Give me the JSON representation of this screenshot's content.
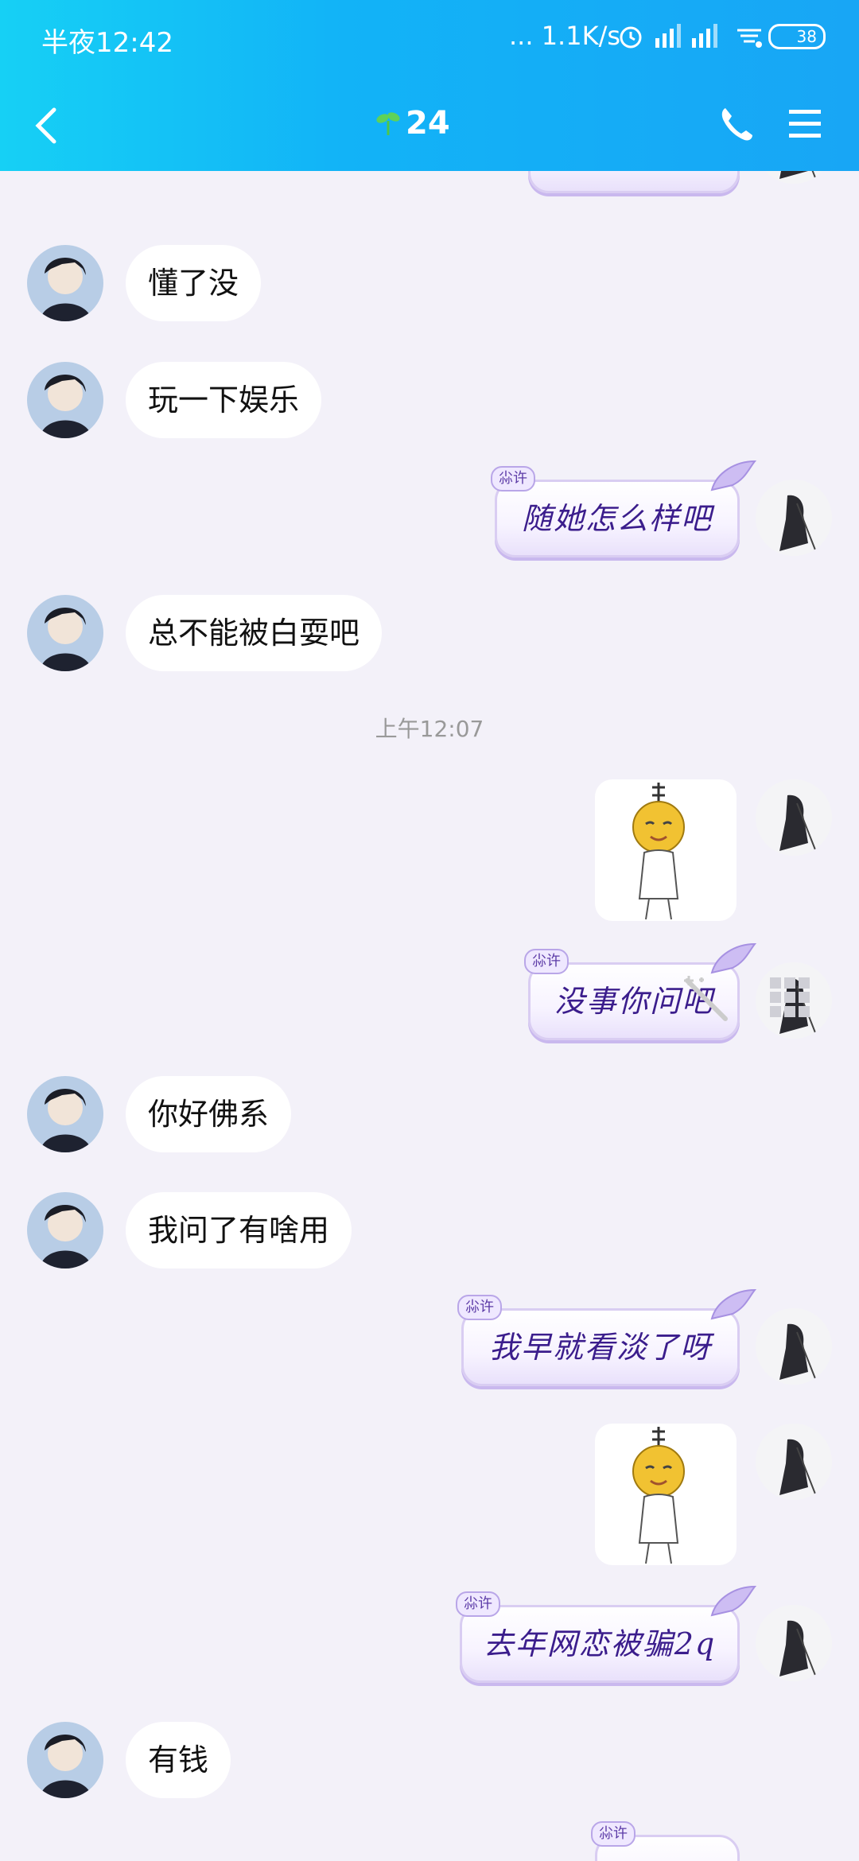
{
  "status_bar": {
    "time": "半夜12:42",
    "network_speed": "... 1.1K/s",
    "battery_level": "38"
  },
  "nav": {
    "title": "24"
  },
  "messages": [
    {
      "side": "right",
      "text": "",
      "partial": true
    },
    {
      "side": "left",
      "text": "懂了没"
    },
    {
      "side": "left",
      "text": "玩一下娱乐"
    },
    {
      "side": "right",
      "tag": "尛许",
      "text": "随她怎么样吧"
    },
    {
      "side": "left",
      "text": "总不能被白耍吧"
    },
    {
      "type": "timestamp",
      "text": "上午12:07"
    },
    {
      "side": "right",
      "type": "sticker",
      "sticker": "hanging-smiley-sticker"
    },
    {
      "side": "right",
      "tag": "尛许",
      "text": "没事你问吧"
    },
    {
      "side": "left",
      "text": "你好佛系"
    },
    {
      "side": "left",
      "text": "我问了有啥用"
    },
    {
      "side": "right",
      "tag": "尛许",
      "text": "我早就看淡了呀"
    },
    {
      "side": "right",
      "type": "sticker",
      "sticker": "hanging-smiley-sticker"
    },
    {
      "side": "right",
      "tag": "尛许",
      "text": "去年网恋被骗2q"
    },
    {
      "side": "left",
      "text": "有钱"
    },
    {
      "side": "right",
      "tag": "尛许",
      "text": "",
      "partial": true
    }
  ],
  "colors": {
    "header_start": "#16d0f5",
    "header_end": "#18a6f5",
    "background": "#f3f1f9",
    "right_text": "#3b1d8c"
  }
}
